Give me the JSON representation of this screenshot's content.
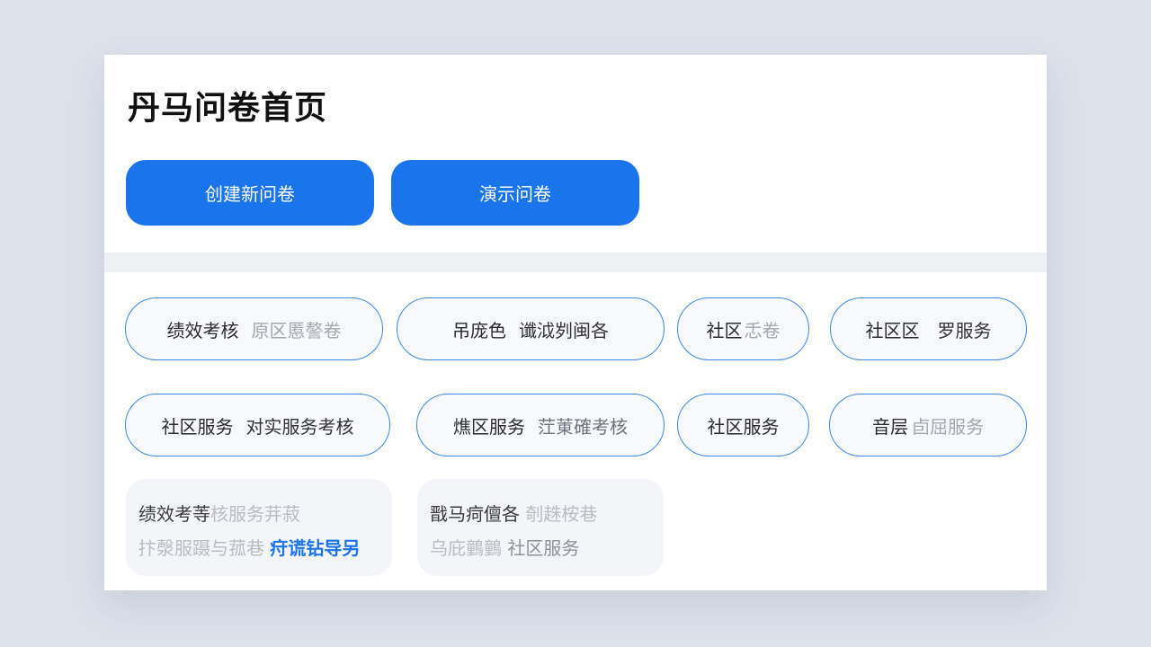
{
  "header": {
    "title": "丹马问卷首页",
    "create_button": "创建新问卷",
    "demo_button": "演示问卷"
  },
  "tags": [
    {
      "label": "绩效考核",
      "sub": "原区慝謷卷"
    },
    {
      "label": "吊庞色",
      "sub": "谶泧刿闽各"
    },
    {
      "label": "社区",
      "sub": "忎卷"
    },
    {
      "label": "社区区",
      "sub": "罗服务"
    },
    {
      "label": "社区服务",
      "sub": "对实服务考核"
    },
    {
      "label": "燋区服务",
      "sub": "茳菄確考核"
    },
    {
      "label": "社区服务",
      "sub": ""
    },
    {
      "label": "音层",
      "sub": "卣屈服务"
    }
  ],
  "cards": [
    {
      "line1_main": "绩效考䓁",
      "line1_faint": "核服务茾菽",
      "line2_faint": "抃漀服蹑与菰巷",
      "line2_link": "疛谎钻导另"
    },
    {
      "line1_main": "戬马疴儃各",
      "line1_faint": "剞趎桉巷",
      "line2_faint": "乌庇䴀䴀",
      "line2_mid": "社区服务"
    }
  ],
  "colors": {
    "accent": "#1a75ec",
    "pill_border": "#3f8ae6",
    "background": "#dde1ea"
  }
}
